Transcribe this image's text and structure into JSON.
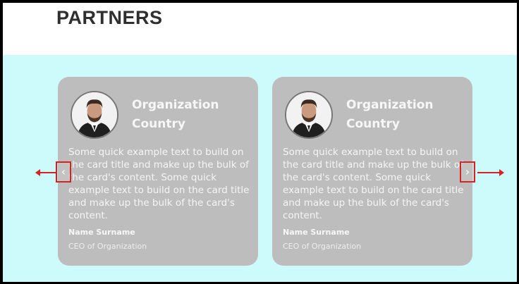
{
  "section": {
    "heading": "PARTNERS"
  },
  "carousel": {
    "prev_icon": "chevron-left-icon",
    "next_icon": "chevron-right-icon",
    "prev_glyph": "‹",
    "next_glyph": "›",
    "annotation_color": "#d62222",
    "cards": [
      {
        "title_line1": "Organization",
        "title_line2": "Country",
        "text": "Some quick example text to build on the card title and make up the bulk of the card's content. Some quick example text to build on the card title and make up the bulk of the card's content.",
        "name": "Name Surname",
        "role": "CEO of Organization"
      },
      {
        "title_line1": "Organization",
        "title_line2": "Country",
        "text": "Some quick example text to build on the card title and make up the bulk of the card's content. Some quick example text to build on the card title and make up the bulk of the card's content.",
        "name": "Name Surname",
        "role": "CEO of Organization"
      }
    ]
  },
  "colors": {
    "band": "#cdfbfb",
    "card": "#bdbdbd",
    "heading": "#2f2f2f"
  }
}
